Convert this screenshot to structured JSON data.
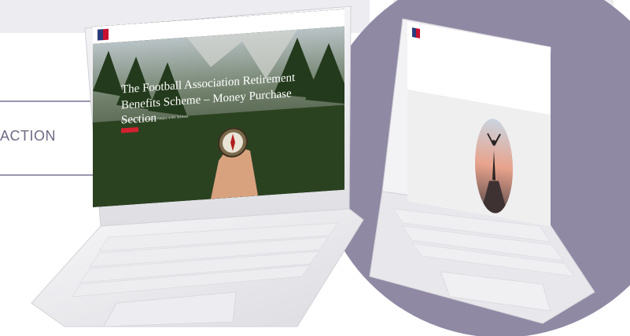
{
  "side_label": "ACTION",
  "laptop_left": {
    "nav_items": [
      "",
      "",
      ""
    ],
    "hero_title": "The Football Association Retirement Benefits Scheme – Money Purchase Section",
    "hero_subtitle": "Explaining the costs and charges in the Scheme",
    "hero_button": ""
  },
  "laptop_right": {
    "nav_items": [
      "",
      "",
      ""
    ],
    "heading": "",
    "intro_paragraph": "",
    "side_text": ""
  },
  "colors": {
    "background_panel": "#ececf1",
    "background_circle": "#8f89a4",
    "accent_text": "#6f6a86",
    "brand_navy": "#2a3b7a",
    "brand_red": "#c8102e",
    "button_red": "#d4202f",
    "laptop_shell": "#f2f2f4"
  }
}
